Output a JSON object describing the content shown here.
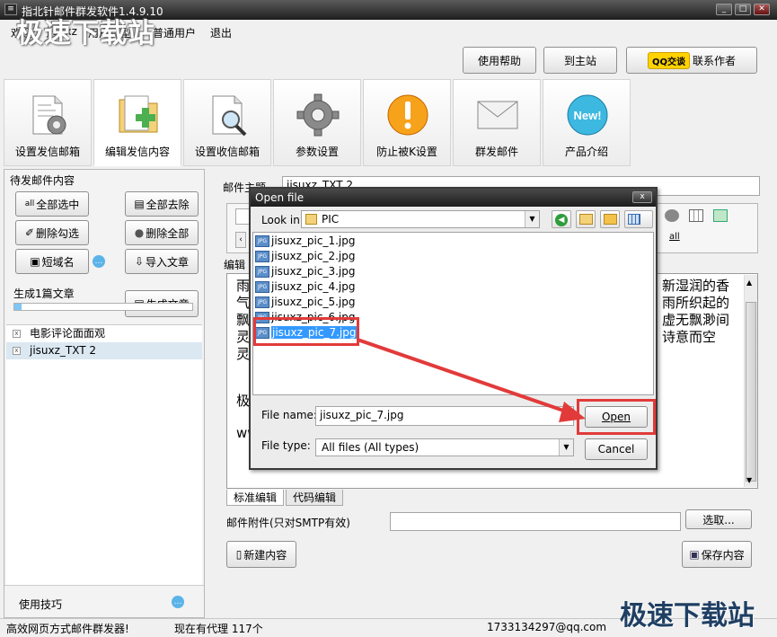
{
  "window": {
    "title": "指北针邮件群发软件1.4.9.10",
    "app_icon": "app-icon",
    "min_label": "_",
    "max_label": "□",
    "close_label": "✕"
  },
  "watermark": {
    "top": "极速下载站",
    "bottom": "极速下载站"
  },
  "menu": {
    "welcome": "欢迎:",
    "user": "jisuxz",
    "user_type_label": "用户类型",
    "user_type": "普通用户",
    "logout": "退出"
  },
  "top_buttons": {
    "help": "使用帮助",
    "home": "到主站",
    "qq_badge": "QQ交谈",
    "contact": "联系作者"
  },
  "tiles": [
    {
      "label": "设置发信邮箱",
      "icon": "gear-document-icon"
    },
    {
      "label": "编辑发信内容",
      "icon": "folder-add-icon"
    },
    {
      "label": "设置收信邮箱",
      "icon": "document-search-icon"
    },
    {
      "label": "参数设置",
      "icon": "gear-icon"
    },
    {
      "label": "防止被K设置",
      "icon": "warning-icon"
    },
    {
      "label": "群发邮件",
      "icon": "envelope-icon"
    },
    {
      "label": "产品介绍",
      "icon": "new-badge-icon",
      "badge": "New!"
    }
  ],
  "left": {
    "header": "待发邮件内容",
    "select_all": "全部选中",
    "remove_all": "全部去除",
    "delete_checked": "删除勾选",
    "delete_all": "删除全部",
    "short_domain": "短域名",
    "import_article": "导入文章",
    "generated": "生成1篇文章",
    "generate_article": "生成文章",
    "progress": 0.04,
    "articles": [
      {
        "title": "电影评论面面观",
        "selected": false
      },
      {
        "title": "jisuxz_TXT 2",
        "selected": true
      }
    ],
    "tips": "使用技巧"
  },
  "right": {
    "subject_label": "邮件主题",
    "subject_value": "jisuxz_TXT 2",
    "edit_label": "编辑",
    "editor_lines_left": [
      "雨",
      "气",
      "飘",
      "灵",
      "灵",
      "",
      "极",
      "",
      "ww"
    ],
    "editor_lines_right": [
      "新湿润的香",
      "雨所织起的",
      "虚无飘渺间",
      "诗意而空"
    ],
    "tab_standard": "标准编辑",
    "tab_code": "代码编辑",
    "attachment_label": "邮件附件(只对SMTP有效)",
    "attachment_value": "",
    "choose": "选取...",
    "new_content": "新建内容",
    "save_content": "保存内容"
  },
  "status": {
    "left": "高效网页方式邮件群发器!",
    "proxies": "现在有代理 117个",
    "email": "1733134297@qq.com"
  },
  "dialog": {
    "title": "Open file",
    "close_label": "x",
    "look_in_label": "Look in:",
    "look_in_value": "PIC",
    "files": [
      {
        "name": "jisuxz_pic_1.jpg",
        "selected": false
      },
      {
        "name": "jisuxz_pic_2.jpg",
        "selected": false
      },
      {
        "name": "jisuxz_pic_3.jpg",
        "selected": false
      },
      {
        "name": "jisuxz_pic_4.jpg",
        "selected": false
      },
      {
        "name": "jisuxz_pic_5.jpg",
        "selected": false
      },
      {
        "name": "jisuxz_pic_6.jpg",
        "selected": false
      },
      {
        "name": "jisuxz_pic_7.jpg",
        "selected": true
      }
    ],
    "file_icon_label": "JPG",
    "filename_label": "File name:",
    "filename_value": "jisuxz_pic_7.jpg",
    "filetype_label": "File type:",
    "filetype_value": "All files (All types)",
    "open": "Open",
    "cancel": "Cancel"
  },
  "colors": {
    "annotation_red": "#e23a3a",
    "selection_blue": "#3399ff",
    "title_bar": "#1e1e1e"
  }
}
